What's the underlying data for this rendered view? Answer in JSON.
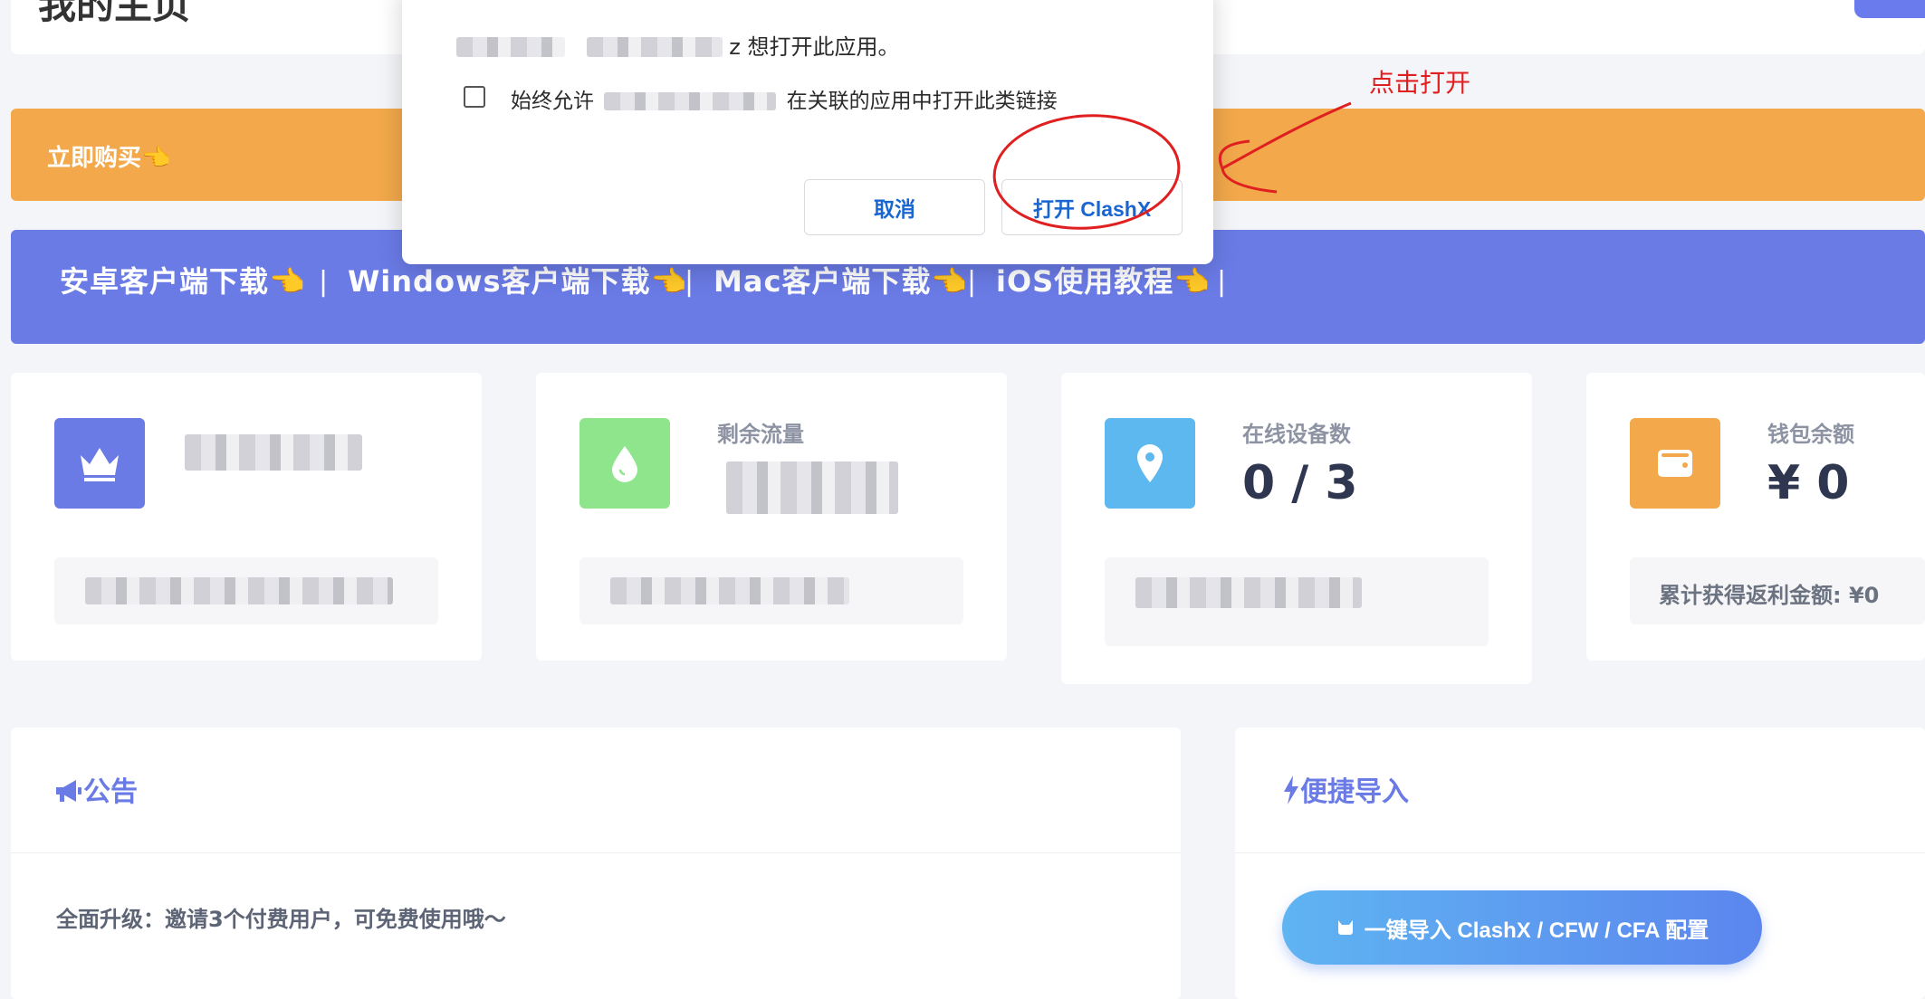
{
  "page": {
    "title": "我的主页"
  },
  "buy": {
    "label": "立即购买👈"
  },
  "downloads": {
    "items": [
      {
        "label": "安卓客户端下载👈"
      },
      {
        "label": "Windows客户端下载👈"
      },
      {
        "label": "Mac客户端下载👈"
      },
      {
        "label": "iOS使用教程👈"
      }
    ],
    "separator": "|"
  },
  "stats": {
    "plan": {
      "label": "",
      "value": "",
      "foot": ""
    },
    "traffic": {
      "label": "剩余流量",
      "value": "",
      "foot": ""
    },
    "devices": {
      "label": "在线设备数",
      "value": "0 / 3",
      "foot": ""
    },
    "wallet": {
      "label": "钱包余额",
      "value": "¥ 0",
      "foot": "累计获得返利金额: ¥0"
    }
  },
  "announcement": {
    "title": "公告",
    "text": "全面升级：邀请3个付费用户，可免费使用哦～"
  },
  "import": {
    "title": "便捷导入",
    "button_label": "一键导入 ClashX / CFW / CFA 配置"
  },
  "dialog": {
    "line1_suffix": "z 想打开此应用。",
    "always_allow_prefix": "始终允许",
    "always_allow_suffix": "在关联的应用中打开此类链接",
    "cancel_label": "取消",
    "open_label": "打开 ClashX"
  },
  "annotation": {
    "label": "点击打开",
    "color": "#e02020"
  },
  "colors": {
    "purple": "#6a7be6",
    "orange": "#f2a84b",
    "green": "#8ee58c",
    "blue": "#5cb8ee",
    "link_blue": "#1a66d1"
  },
  "icons": {
    "plan": "crown-icon",
    "traffic": "droplet-icon",
    "devices": "map-pin-icon",
    "wallet": "wallet-icon",
    "announce": "megaphone-icon",
    "import": "bolt-icon",
    "import_button": "cat-icon"
  }
}
